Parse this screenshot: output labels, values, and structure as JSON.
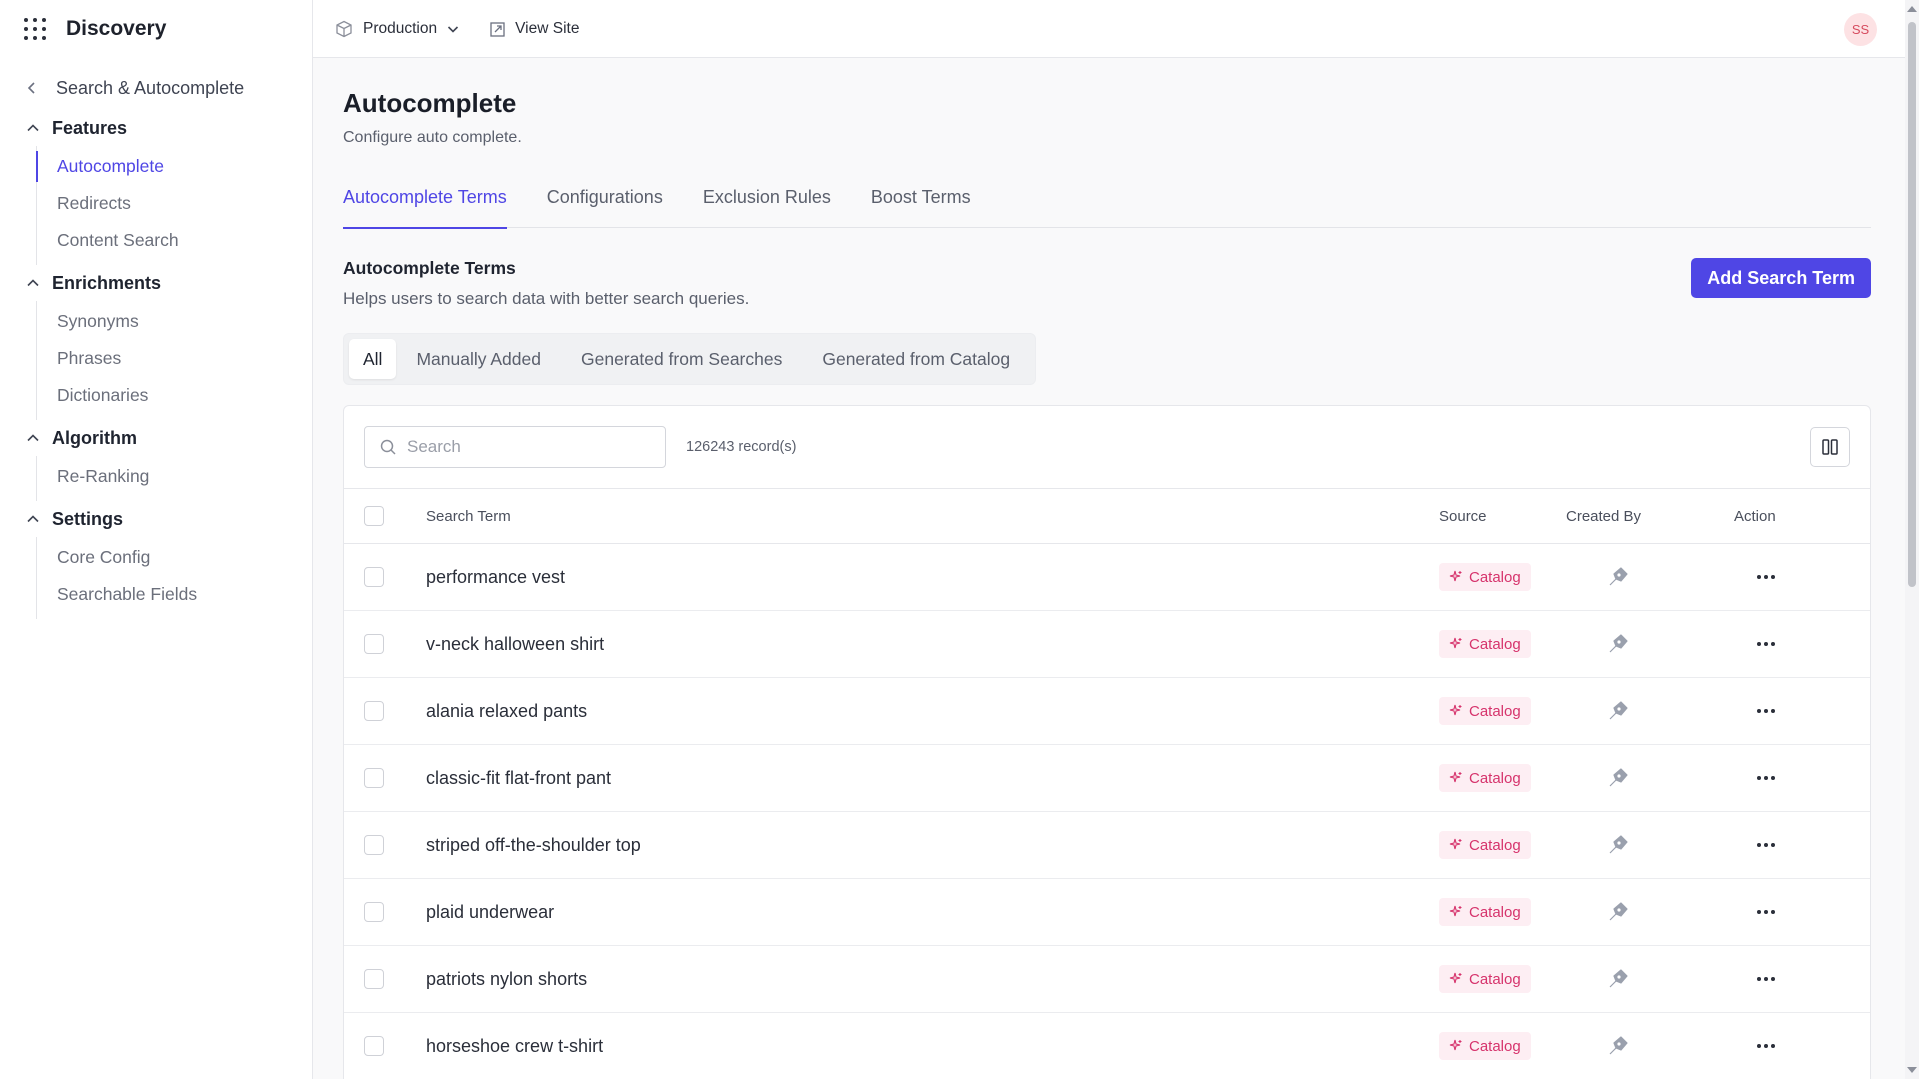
{
  "app": {
    "title": "Discovery"
  },
  "sidebar": {
    "back_label": "Search & Autocomplete",
    "sections": [
      {
        "title": "Features",
        "items": [
          "Autocomplete",
          "Redirects",
          "Content Search"
        ]
      },
      {
        "title": "Enrichments",
        "items": [
          "Synonyms",
          "Phrases",
          "Dictionaries"
        ]
      },
      {
        "title": "Algorithm",
        "items": [
          "Re-Ranking"
        ]
      },
      {
        "title": "Settings",
        "items": [
          "Core Config",
          "Searchable Fields"
        ]
      }
    ],
    "active_item": "Autocomplete"
  },
  "topbar": {
    "environment": "Production",
    "view_site": "View Site",
    "avatar_initials": "SS"
  },
  "page": {
    "title": "Autocomplete",
    "subtitle": "Configure auto complete.",
    "tabs": [
      "Autocomplete Terms",
      "Configurations",
      "Exclusion Rules",
      "Boost Terms"
    ],
    "active_tab": "Autocomplete Terms"
  },
  "section": {
    "title": "Autocomplete Terms",
    "subtitle": "Helps users to search data with better search queries.",
    "add_button": "Add Search Term"
  },
  "filters": {
    "options": [
      "All",
      "Manually Added",
      "Generated from Searches",
      "Generated from Catalog"
    ],
    "active": "All"
  },
  "table": {
    "search_placeholder": "Search",
    "record_count": "126243 record(s)",
    "columns": {
      "term": "Search Term",
      "source": "Source",
      "created_by": "Created By",
      "action": "Action"
    },
    "rows": [
      {
        "term": "performance vest",
        "source": "Catalog",
        "created_by_icon": "pen-nib-icon"
      },
      {
        "term": "v-neck halloween shirt",
        "source": "Catalog",
        "created_by_icon": "pen-nib-icon"
      },
      {
        "term": "alania relaxed pants",
        "source": "Catalog",
        "created_by_icon": "pen-nib-icon"
      },
      {
        "term": "classic-fit flat-front pant",
        "source": "Catalog",
        "created_by_icon": "pen-nib-icon"
      },
      {
        "term": "striped off-the-shoulder top",
        "source": "Catalog",
        "created_by_icon": "pen-nib-icon"
      },
      {
        "term": "plaid underwear",
        "source": "Catalog",
        "created_by_icon": "pen-nib-icon"
      },
      {
        "term": "patriots nylon shorts",
        "source": "Catalog",
        "created_by_icon": "pen-nib-icon"
      },
      {
        "term": "horseshoe crew t-shirt",
        "source": "Catalog",
        "created_by_icon": "pen-nib-icon"
      }
    ]
  },
  "colors": {
    "accent": "#4f46e5",
    "badge_text": "#d6336c",
    "badge_bg": "#fdeef3",
    "avatar_bg": "#fde2e4"
  }
}
